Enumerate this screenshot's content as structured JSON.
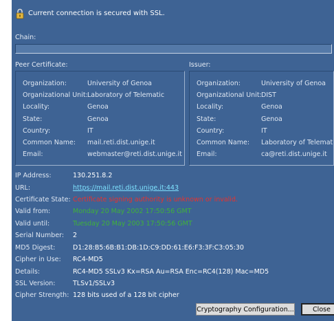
{
  "header": {
    "text": "Current connection is secured with SSL."
  },
  "chain": {
    "label": "Chain:"
  },
  "peer": {
    "label": "Peer Certificate:",
    "fields": [
      {
        "key": "Organization:",
        "value": "University of Genoa"
      },
      {
        "key": "Organizational Unit:",
        "value": "Laboratory of Telematic"
      },
      {
        "key": "Locality:",
        "value": "Genoa"
      },
      {
        "key": "State:",
        "value": "Genoa"
      },
      {
        "key": "Country:",
        "value": "IT"
      },
      {
        "key": "Common Name:",
        "value": "mail.reti.dist.unige.it"
      },
      {
        "key": "Email:",
        "value": "webmaster@reti.dist.unige.it"
      }
    ]
  },
  "issuer": {
    "label": "Issuer:",
    "fields": [
      {
        "key": "Organization:",
        "value": "University of Genoa"
      },
      {
        "key": "Organizational Unit:",
        "value": "DIST"
      },
      {
        "key": "Locality:",
        "value": "Genoa"
      },
      {
        "key": "State:",
        "value": "Genoa"
      },
      {
        "key": "Country:",
        "value": "IT"
      },
      {
        "key": "Common Name:",
        "value": "Laboratory of Telematic"
      },
      {
        "key": "Email:",
        "value": "ca@reti.dist.unige.it"
      }
    ]
  },
  "info": [
    {
      "key": "IP Address:",
      "value": "130.251.8.2",
      "style": "normal"
    },
    {
      "key": "URL:",
      "value": "https://mail.reti.dist.unige.it:443",
      "style": "link"
    },
    {
      "key": "Certificate State:",
      "value": "Certificate signing authority is unknown or invalid.",
      "style": "err"
    },
    {
      "key": "Valid from:",
      "value": "Monday 20 May 2002 17:50:56 GMT",
      "style": "ok"
    },
    {
      "key": "Valid until:",
      "value": "Tuesday 20 May 2003 17:50:56 GMT",
      "style": "ok"
    },
    {
      "key": "Serial Number:",
      "value": "2",
      "style": "normal"
    },
    {
      "key": "MD5 Digest:",
      "value": "D1:28:B5:6B:B1:DB:1D:C9:DD:61:E6:F3:3F:C3:05:30",
      "style": "normal"
    },
    {
      "key": "Cipher in Use:",
      "value": "RC4-MD5",
      "style": "normal"
    },
    {
      "key": "Details:",
      "value": "RC4-MD5 SSLv3 Kx=RSA Au=RSA Enc=RC4(128) Mac=MD5",
      "style": "normal"
    },
    {
      "key": "SSL Version:",
      "value": "TLSv1/SSLv3",
      "style": "normal"
    },
    {
      "key": "Cipher Strength:",
      "value": "128 bits used of a 128 bit cipher",
      "style": "normal"
    }
  ],
  "buttons": {
    "crypto": "Cryptography Configuration...",
    "close": "Close"
  },
  "colors": {
    "background": "#3e6394",
    "link": "#7fe3ff",
    "error": "#e8322e",
    "valid": "#3fb23a"
  },
  "icons": {
    "header": "lock-icon"
  }
}
